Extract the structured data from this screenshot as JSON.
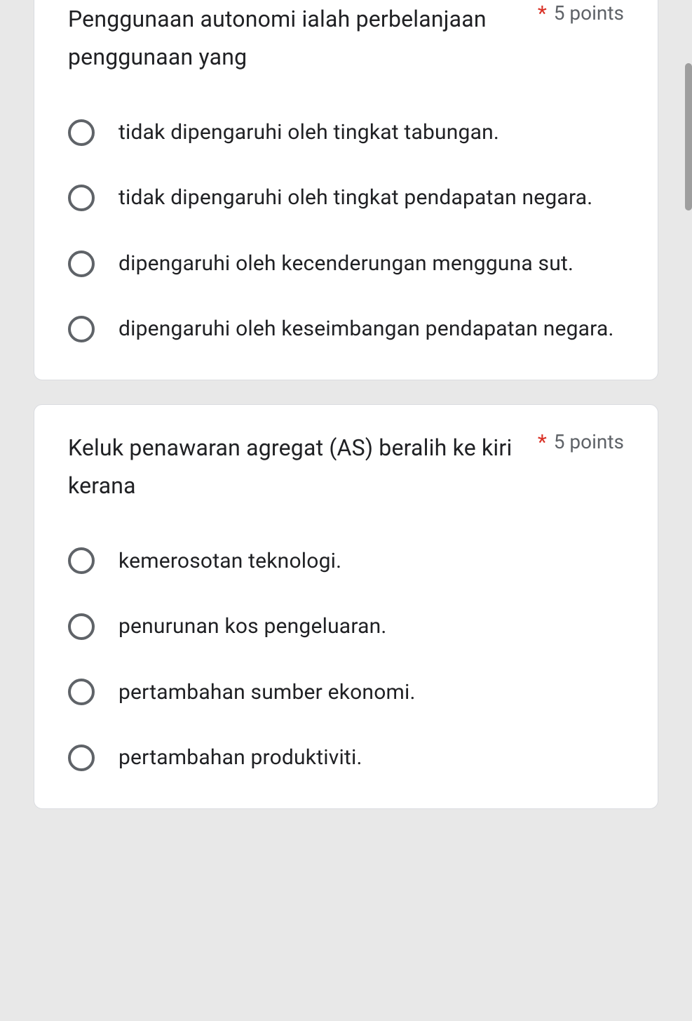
{
  "questions": [
    {
      "title": "Penggunaan autonomi ialah perbelanjaan penggunaan yang",
      "required_mark": "*",
      "points": "5 points",
      "options": [
        "tidak dipengaruhi oleh tingkat tabungan.",
        "tidak dipengaruhi oleh tingkat pendapatan negara.",
        "dipengaruhi oleh kecenderungan mengguna sut.",
        "dipengaruhi oleh keseimbangan pendapatan negara."
      ]
    },
    {
      "title": "Keluk penawaran agregat (AS) beralih ke kiri kerana",
      "required_mark": "*",
      "points": "5 points",
      "options": [
        "kemerosotan teknologi.",
        "penurunan kos pengeluaran.",
        "pertambahan sumber ekonomi.",
        "pertambahan produktiviti."
      ]
    }
  ]
}
